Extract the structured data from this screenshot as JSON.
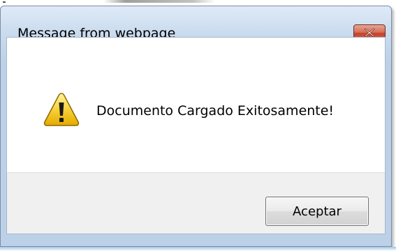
{
  "dialog": {
    "title": "Message from webpage",
    "message": "Documento Cargado Exitosamente!",
    "accept_label": "Aceptar",
    "icon": "warning-icon"
  },
  "colors": {
    "titlebar": "#c9dbee",
    "close_button": "#c4432a",
    "warning_yellow": "#f5c518",
    "button_area": "#f0f0f0"
  }
}
